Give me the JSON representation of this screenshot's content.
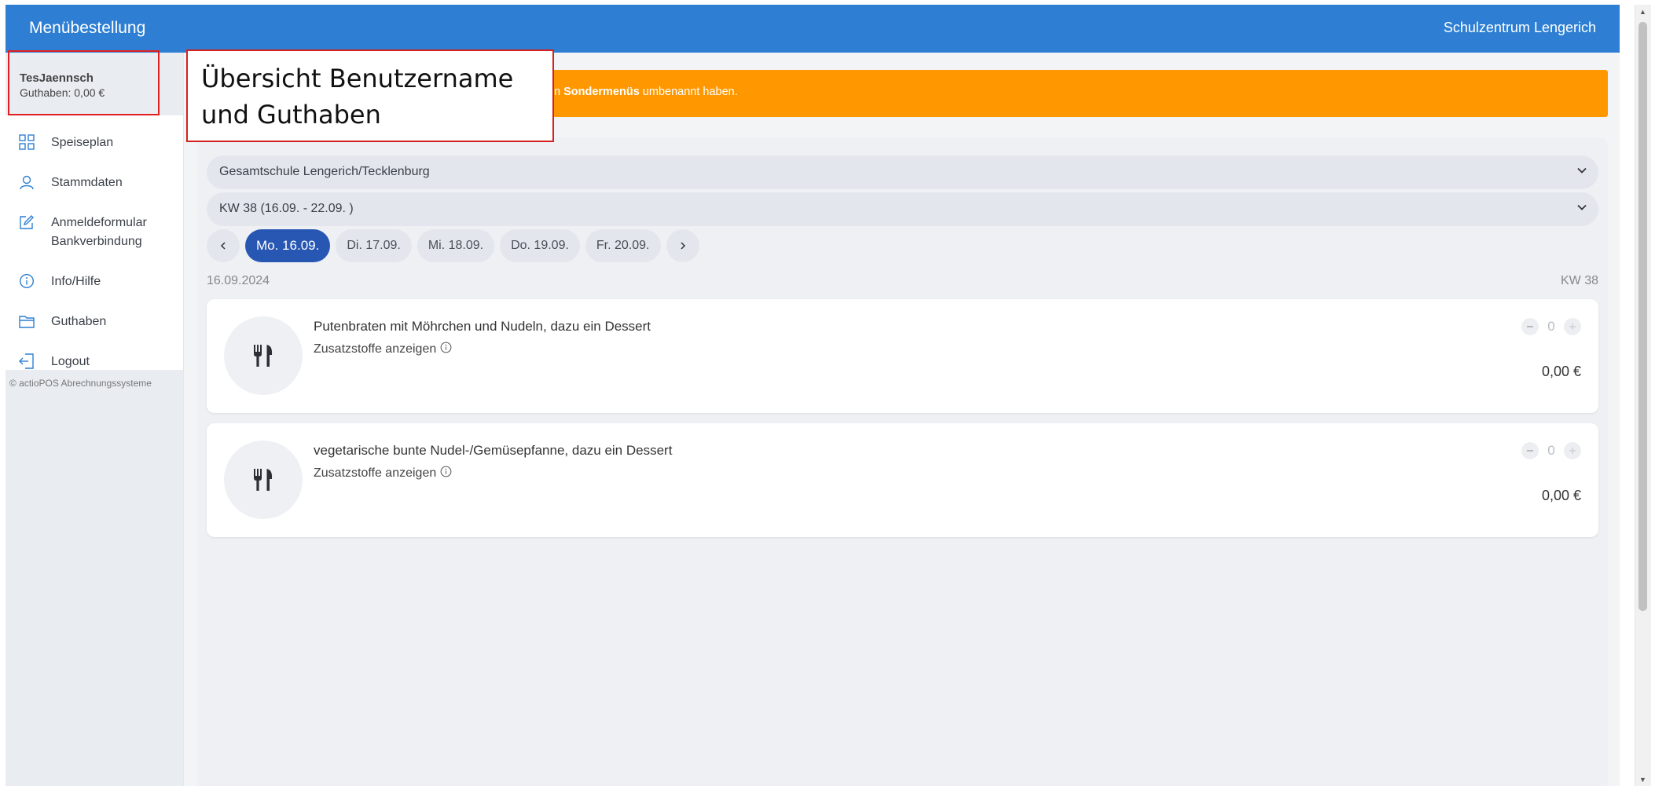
{
  "header": {
    "title": "Menübestellung",
    "school": "Schulzentrum Lengerich"
  },
  "user": {
    "name": "TesJaennsch",
    "balance": "Guthaben: 0,00 €"
  },
  "nav": {
    "items": [
      {
        "label": "Speiseplan",
        "icon": "grid-icon"
      },
      {
        "label": "Stammdaten",
        "icon": "user-icon"
      },
      {
        "label": "Anmeldeformular",
        "label2": "Bankverbindung",
        "icon": "edit-icon"
      },
      {
        "label": "Info/Hilfe",
        "icon": "info-icon"
      },
      {
        "label": "Guthaben",
        "icon": "wallet-icon"
      },
      {
        "label": "Logout",
        "icon": "logout-icon"
      }
    ]
  },
  "footer": {
    "copyright": "© actioPOS Abrechnungssysteme"
  },
  "notice": {
    "prefix": "n ",
    "bold": "Sondermenüs",
    "suffix": " umbenannt haben."
  },
  "selects": {
    "school": "Gesamtschule Lengerich/Tecklenburg",
    "week": "KW 38 (16.09. - 22.09. )"
  },
  "days": [
    {
      "label": "Mo. 16.09.",
      "active": true
    },
    {
      "label": "Di. 17.09.",
      "active": false
    },
    {
      "label": "Mi. 18.09.",
      "active": false
    },
    {
      "label": "Do. 19.09.",
      "active": false
    },
    {
      "label": "Fr. 20.09.",
      "active": false
    }
  ],
  "date_row": {
    "date": "16.09.2024",
    "kw": "KW 38"
  },
  "meals": [
    {
      "name": "Putenbraten mit Möhrchen und Nudeln, dazu ein Dessert",
      "additives": "Zusatzstoffe anzeigen",
      "quantity": "0",
      "price": "0,00 €"
    },
    {
      "name": "vegetarische bunte Nudel-/Gemüsepfanne, dazu ein Dessert",
      "additives": "Zusatzstoffe anzeigen",
      "quantity": "0",
      "price": "0,00 €"
    }
  ],
  "annotation": {
    "line1": "Übersicht Benutzername",
    "line2": "und Guthaben"
  },
  "colors": {
    "header": "#2e7fd3",
    "notice": "#ff9800",
    "active_day": "#2757b3",
    "annotation_border": "#e02020"
  }
}
